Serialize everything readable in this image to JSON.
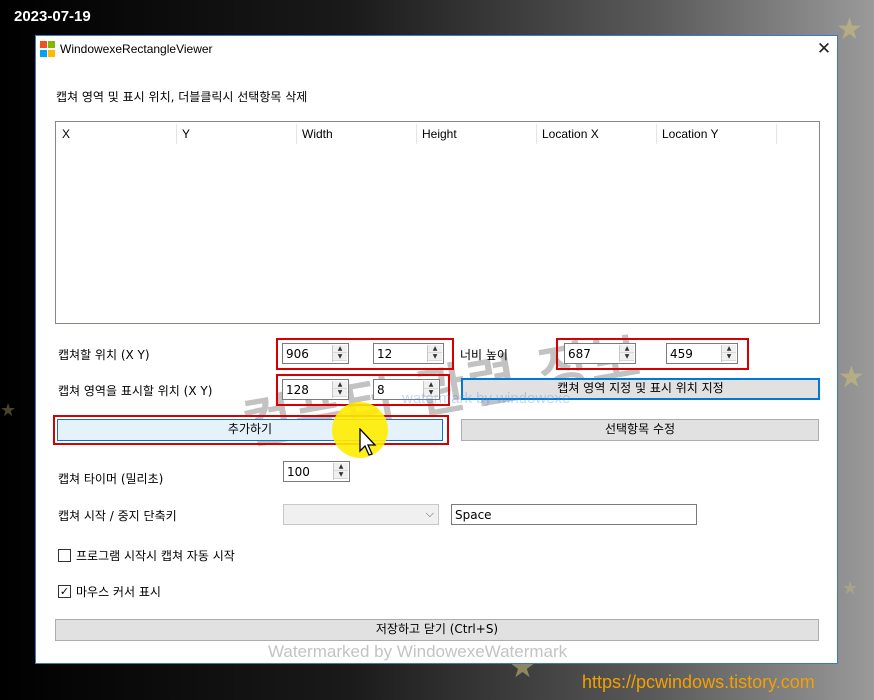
{
  "overlay": {
    "date": "2023-07-19",
    "url": "https://pcwindows.tistory.com",
    "watermark_big": "컴퓨터 관련 정보",
    "watermark_small": "watermark by windowexe",
    "watermark_bottom": "Watermarked by WindowexeWatermark"
  },
  "window": {
    "title": "WindowexeRectangleViewer",
    "close_glyph": "✕"
  },
  "instructions": "캡쳐 영역 및 표시 위치, 더블클릭시 선택항목 삭제",
  "list": {
    "columns": [
      "X",
      "Y",
      "Width",
      "Height",
      "Location X",
      "Location Y"
    ],
    "rows": []
  },
  "capture_position": {
    "label": "캡쳐할 위치 (X Y)",
    "x": "906",
    "y": "12"
  },
  "size": {
    "label": "너비 높이",
    "width": "687",
    "height": "459"
  },
  "display_position": {
    "label": "캡쳐 영역을 표시할 위치 (X Y)",
    "x": "128",
    "y": "8"
  },
  "buttons": {
    "set_area": "캡쳐 영역 지정 및 표시 위치 지정",
    "add": "추가하기",
    "edit_selected": "선택항목 수정",
    "save_close": "저장하고 닫기 (Ctrl+S)"
  },
  "timer": {
    "label": "캡쳐 타이머 (밀리초)",
    "value": "100"
  },
  "hotkey": {
    "label": "캡쳐 시작 / 중지 단축키",
    "combo_value": "",
    "value": "Space"
  },
  "options": {
    "autostart_label": "프로그램 시작시 캡쳐 자동 시작",
    "autostart_checked": false,
    "show_cursor_label": "마우스 커서 표시",
    "show_cursor_checked": true
  },
  "colors": {
    "accent": "#0078d7",
    "highlight_box": "#d50000",
    "window_border": "#3c78c3",
    "url": "#f5a000"
  },
  "icons": {
    "app": "app-tiles-icon",
    "close": "close-icon",
    "cursor": "mouse-cursor-icon",
    "check": "check-icon",
    "spin": "spin-arrows-icon",
    "dropdown": "chevron-down-icon"
  }
}
